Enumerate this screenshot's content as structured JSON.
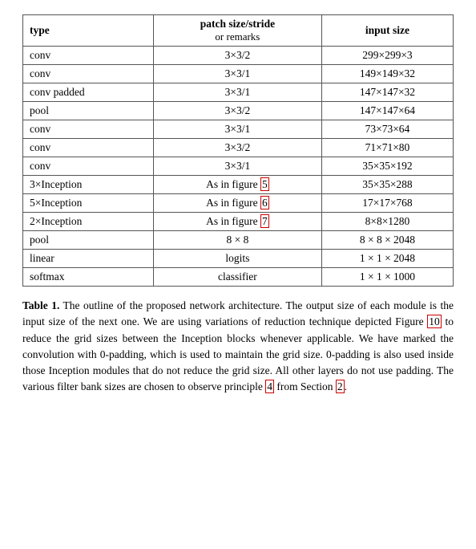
{
  "table": {
    "headers": {
      "type": "type",
      "patch": "patch size/stride",
      "remarks": "or remarks",
      "input": "input size"
    },
    "rows": [
      {
        "type": "conv",
        "patch": "3×3/2",
        "input": "299×299×3"
      },
      {
        "type": "conv",
        "patch": "3×3/1",
        "input": "149×149×32"
      },
      {
        "type": "conv padded",
        "patch": "3×3/1",
        "input": "147×147×32"
      },
      {
        "type": "pool",
        "patch": "3×3/2",
        "input": "147×147×64"
      },
      {
        "type": "conv",
        "patch": "3×3/1",
        "input": "73×73×64"
      },
      {
        "type": "conv",
        "patch": "3×3/2",
        "input": "71×71×80"
      },
      {
        "type": "conv",
        "patch": "3×3/1",
        "input": "35×35×192"
      },
      {
        "type": "3×Inception",
        "patch": "As in figure 5",
        "input": "35×35×288",
        "highlight_patch": true
      },
      {
        "type": "5×Inception",
        "patch": "As in figure 6",
        "input": "17×17×768",
        "highlight_patch": true
      },
      {
        "type": "2×Inception",
        "patch": "As in figure 7",
        "input": "8×8×1280",
        "highlight_patch": true
      },
      {
        "type": "pool",
        "patch": "8 × 8",
        "input": "8 × 8 × 2048"
      },
      {
        "type": "linear",
        "patch": "logits",
        "input": "1 × 1 × 2048"
      },
      {
        "type": "softmax",
        "patch": "classifier",
        "input": "1 × 1 × 1000"
      }
    ]
  },
  "caption": {
    "label": "Table 1.",
    "text1": " The outline of the proposed network architecture.  The output size of each module is the input size of the next one.  We are using variations of reduction technique depicted Figure ",
    "link1": "10",
    "text2": " to reduce the grid sizes between the Inception blocks whenever applicable. We have marked the convolution with 0-padding, which is used to maintain the grid size.  0-padding is also used inside those Inception modules that do not reduce the grid size. All other layers do not use padding. The various filter bank sizes are chosen to observe principle ",
    "link2": "4",
    "text3": " from Section ",
    "link3": "2",
    "text4": "."
  }
}
